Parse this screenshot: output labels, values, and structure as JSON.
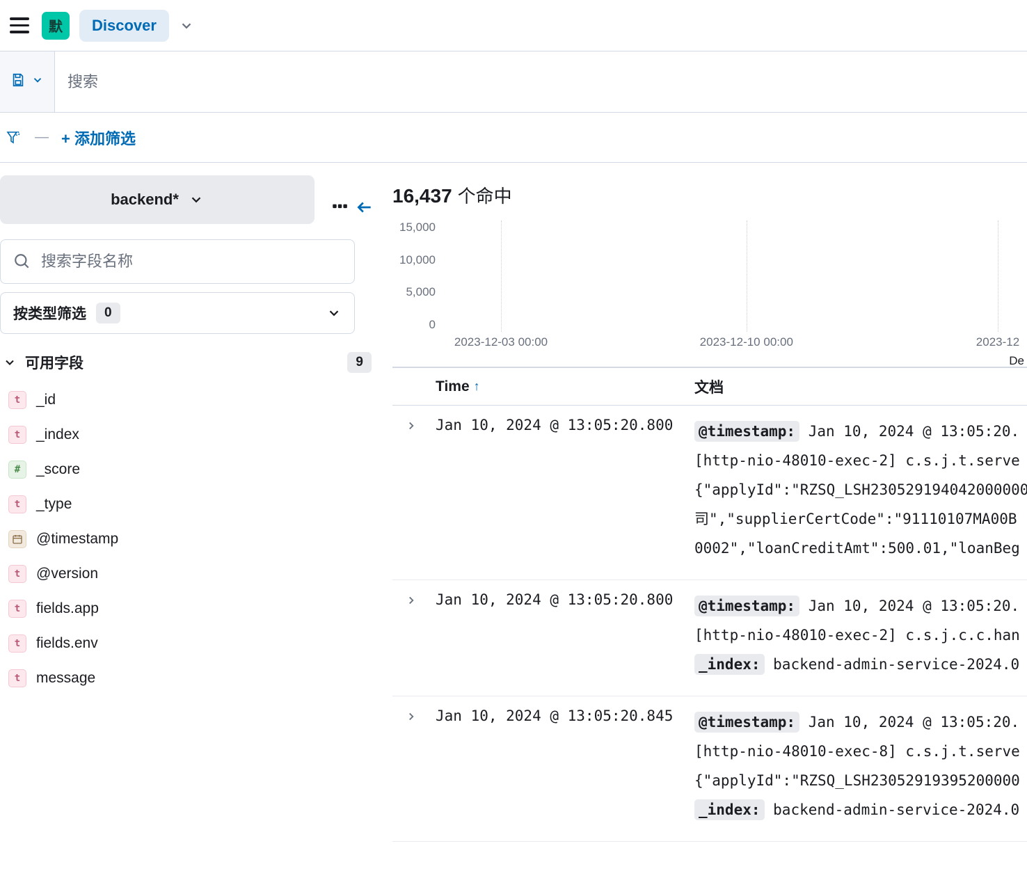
{
  "topbar": {
    "app_badge": "默",
    "discover_label": "Discover"
  },
  "search": {
    "placeholder": "搜索",
    "value": ""
  },
  "filters": {
    "add_filter_label": "+ 添加筛选"
  },
  "sidebar": {
    "index_pattern": "backend*",
    "field_search_placeholder": "搜索字段名称",
    "type_filter_label": "按类型筛选",
    "type_filter_count": "0",
    "available_fields_label": "可用字段",
    "available_fields_count": "9",
    "fields": [
      {
        "type": "t",
        "name": "_id"
      },
      {
        "type": "t",
        "name": "_index"
      },
      {
        "type": "n",
        "name": "_score"
      },
      {
        "type": "t",
        "name": "_type"
      },
      {
        "type": "d",
        "name": "@timestamp"
      },
      {
        "type": "t",
        "name": "@version"
      },
      {
        "type": "t",
        "name": "fields.app"
      },
      {
        "type": "t",
        "name": "fields.env"
      },
      {
        "type": "t",
        "name": "message"
      }
    ]
  },
  "results": {
    "hit_count": "16,437",
    "hit_suffix": "个命中",
    "columns": {
      "time": "Time",
      "doc": "文档"
    },
    "rows": [
      {
        "time": "Jan 10, 2024 @ 13:05:20.800",
        "doc_lines": [
          {
            "tag": "@timestamp:",
            "text": " Jan 10, 2024 @ 13:05:20."
          },
          {
            "text": "[http-nio-48010-exec-2] c.s.j.t.serve"
          },
          {
            "text": "{\"applyId\":\"RZSQ_LSH230529194042000000"
          },
          {
            "text": "司\",\"supplierCertCode\":\"91110107MA00B"
          },
          {
            "text": "0002\",\"loanCreditAmt\":500.01,\"loanBeg"
          }
        ]
      },
      {
        "time": "Jan 10, 2024 @ 13:05:20.800",
        "doc_lines": [
          {
            "tag": "@timestamp:",
            "text": " Jan 10, 2024 @ 13:05:20."
          },
          {
            "text": "[http-nio-48010-exec-2] c.s.j.c.c.han"
          },
          {
            "tag": "_index:",
            "text": " backend-admin-service-2024.0"
          }
        ]
      },
      {
        "time": "Jan 10, 2024 @ 13:05:20.845",
        "doc_lines": [
          {
            "tag": "@timestamp:",
            "text": " Jan 10, 2024 @ 13:05:20."
          },
          {
            "text": "[http-nio-48010-exec-8] c.s.j.t.serve"
          },
          {
            "text": "{\"applyId\":\"RZSQ_LSH23052919395200000"
          },
          {
            "tag": "_index:",
            "text": " backend-admin-service-2024.0"
          }
        ]
      }
    ]
  },
  "chart_data": {
    "type": "bar",
    "y_ticks": [
      "15,000",
      "10,000",
      "5,000",
      "0"
    ],
    "x_ticks": [
      "2023-12-03 00:00",
      "2023-12-10 00:00",
      "2023-12"
    ],
    "ylim": [
      0,
      15000
    ],
    "footer_label_fragment": "De",
    "categories": [],
    "values": []
  }
}
